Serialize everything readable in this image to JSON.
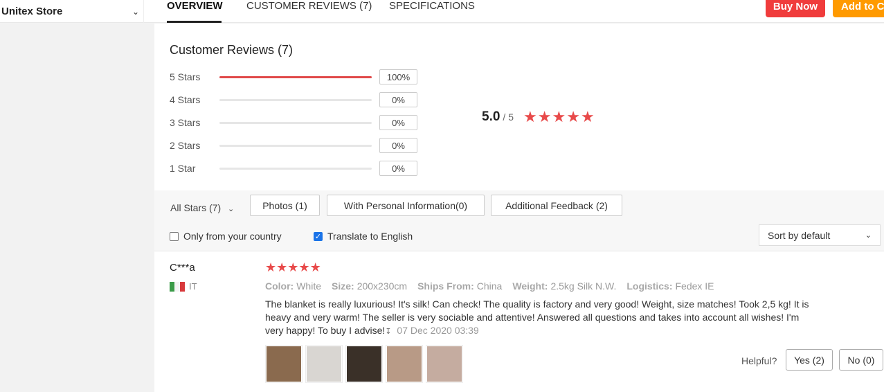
{
  "header": {
    "store_name": "Unitex Store",
    "tabs": [
      "OVERVIEW",
      "CUSTOMER REVIEWS (7)",
      "SPECIFICATIONS"
    ],
    "buy_now": "Buy Now",
    "add_to_cart": "Add to Cart"
  },
  "reviews": {
    "title": "Customer Reviews (7)",
    "breakdown": [
      {
        "label": "5 Stars",
        "percent": "100%",
        "fill": 1.0
      },
      {
        "label": "4 Stars",
        "percent": "0%",
        "fill": 0
      },
      {
        "label": "3 Stars",
        "percent": "0%",
        "fill": 0
      },
      {
        "label": "2 Stars",
        "percent": "0%",
        "fill": 0
      },
      {
        "label": "1 Star",
        "percent": "0%",
        "fill": 0
      }
    ],
    "score": "5.0",
    "out_of": "/ 5",
    "stars": 5
  },
  "filters": {
    "all_stars": "All Stars (7)",
    "photos": "Photos (1)",
    "personal_info": "With Personal Information(0)",
    "additional_feedback": "Additional Feedback (2)",
    "only_country": "Only from your country",
    "only_country_checked": false,
    "translate": "Translate to English",
    "translate_checked": true,
    "sort": "Sort by default"
  },
  "review": {
    "author": "C***a",
    "country_code": "IT",
    "stars": 5,
    "color_label": "Color:",
    "color_value": "White",
    "size_label": "Size:",
    "size_value": "200x230cm",
    "ships_label": "Ships From:",
    "ships_value": "China",
    "weight_label": "Weight:",
    "weight_value": "2.5kg Silk N.W.",
    "logistics_label": "Logistics:",
    "logistics_value": "Fedex IE",
    "body": "The blanket is really luxurious! It's silk! Can check! The quality is factory and very good! Weight, size matches! Took 2,5 kg! It is heavy and very warm! The seller is very sociable and attentive! Answered all questions and takes into account all wishes! I'm very happy! To buy I advise!",
    "date": "07 Dec 2020 03:39",
    "helpful": "Helpful?",
    "yes": "Yes (2)",
    "no": "No (0)",
    "photo_colors": [
      "#8a6a4e",
      "#d9d6d2",
      "#3a3028",
      "#b89a86",
      "#c5aca0"
    ]
  },
  "colors": {
    "accent_red": "#f03c3c",
    "accent_orange": "#ff9a00",
    "star_red": "#e84a4a"
  }
}
